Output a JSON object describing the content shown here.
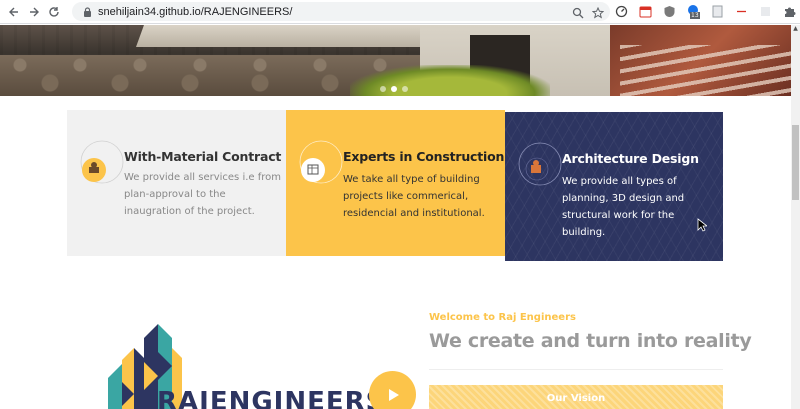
{
  "browser": {
    "url": "snehiljain34.github.io/RAJENGINEERS/",
    "icons": [
      "back-icon",
      "forward-icon",
      "reload-icon",
      "lock-icon",
      "zoom-icon",
      "star-icon",
      "performance-icon",
      "extension-icon",
      "puzzle-icon",
      "avatar",
      "more-icon"
    ],
    "extension_badge": "13"
  },
  "hero": {
    "slides": 3,
    "active_slide": 2
  },
  "features": [
    {
      "title": "With-Material Contract",
      "description": "We provide all services i.e from plan-approval to the inaugration of the project.",
      "icon": "worker-icon"
    },
    {
      "title": "Experts in Construction",
      "description": "We take all type of building projects like commerical, residencial and institutional.",
      "icon": "plan-icon"
    },
    {
      "title": "Architecture Design",
      "description": "We provide all types of planning, 3D design and structural work for the building.",
      "icon": "architect-icon"
    }
  ],
  "about": {
    "welcome": "Welcome to Raj Engineers",
    "headline": "We create and turn into reality",
    "vision_label": "Our Vision",
    "brand": "RAJENGINEERS"
  },
  "colors": {
    "accent": "#fcc44a",
    "navy": "#2d3561",
    "grey_card": "#f1f1f1"
  }
}
